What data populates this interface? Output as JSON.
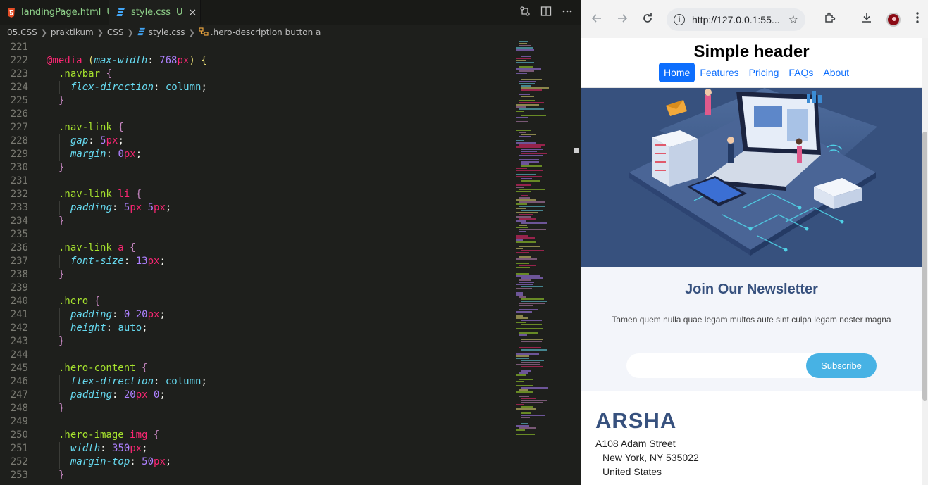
{
  "editor": {
    "tabs": [
      {
        "name": "landingPage.html",
        "status": "U"
      },
      {
        "name": "style.css",
        "status": "U",
        "close": "×"
      }
    ],
    "breadcrumb": [
      "05.CSS",
      "praktikum",
      "CSS",
      "style.css",
      ".hero-description button a"
    ],
    "lines": [
      {
        "n": "221",
        "indent": 0,
        "t": []
      },
      {
        "n": "222",
        "indent": 0,
        "t": [
          [
            "at",
            "@media "
          ],
          [
            "paren",
            "("
          ],
          [
            "prop",
            "max-width"
          ],
          [
            "punc",
            ": "
          ],
          [
            "num",
            "768"
          ],
          [
            "unit",
            "px"
          ],
          [
            "paren",
            ")"
          ],
          [
            "punc",
            " "
          ],
          [
            "paren",
            "{"
          ]
        ]
      },
      {
        "n": "223",
        "indent": 1,
        "t": [
          [
            "sel",
            ".navbar "
          ],
          [
            "brace",
            "{"
          ]
        ]
      },
      {
        "n": "224",
        "indent": 2,
        "t": [
          [
            "prop",
            "flex-direction"
          ],
          [
            "punc",
            ": "
          ],
          [
            "val",
            "column"
          ],
          [
            "punc",
            ";"
          ]
        ]
      },
      {
        "n": "225",
        "indent": 1,
        "t": [
          [
            "brace",
            "}"
          ]
        ]
      },
      {
        "n": "226",
        "indent": 0,
        "t": []
      },
      {
        "n": "227",
        "indent": 1,
        "t": [
          [
            "sel",
            ".nav-link "
          ],
          [
            "brace",
            "{"
          ]
        ]
      },
      {
        "n": "228",
        "indent": 2,
        "t": [
          [
            "prop",
            "gap"
          ],
          [
            "punc",
            ": "
          ],
          [
            "num",
            "5"
          ],
          [
            "unit",
            "px"
          ],
          [
            "punc",
            ";"
          ]
        ]
      },
      {
        "n": "229",
        "indent": 2,
        "t": [
          [
            "prop",
            "margin"
          ],
          [
            "punc",
            ": "
          ],
          [
            "num",
            "0"
          ],
          [
            "unit",
            "px"
          ],
          [
            "punc",
            ";"
          ]
        ]
      },
      {
        "n": "230",
        "indent": 1,
        "t": [
          [
            "brace",
            "}"
          ]
        ]
      },
      {
        "n": "231",
        "indent": 0,
        "t": []
      },
      {
        "n": "232",
        "indent": 1,
        "t": [
          [
            "sel",
            ".nav-link "
          ],
          [
            "tag",
            "li "
          ],
          [
            "brace",
            "{"
          ]
        ]
      },
      {
        "n": "233",
        "indent": 2,
        "t": [
          [
            "prop",
            "padding"
          ],
          [
            "punc",
            ": "
          ],
          [
            "num",
            "5"
          ],
          [
            "unit",
            "px "
          ],
          [
            "num",
            "5"
          ],
          [
            "unit",
            "px"
          ],
          [
            "punc",
            ";"
          ]
        ]
      },
      {
        "n": "234",
        "indent": 1,
        "t": [
          [
            "brace",
            "}"
          ]
        ]
      },
      {
        "n": "235",
        "indent": 0,
        "t": []
      },
      {
        "n": "236",
        "indent": 1,
        "t": [
          [
            "sel",
            ".nav-link "
          ],
          [
            "tag",
            "a "
          ],
          [
            "brace",
            "{"
          ]
        ]
      },
      {
        "n": "237",
        "indent": 2,
        "t": [
          [
            "prop",
            "font-size"
          ],
          [
            "punc",
            ": "
          ],
          [
            "num",
            "13"
          ],
          [
            "unit",
            "px"
          ],
          [
            "punc",
            ";"
          ]
        ]
      },
      {
        "n": "238",
        "indent": 1,
        "t": [
          [
            "brace",
            "}"
          ]
        ]
      },
      {
        "n": "239",
        "indent": 0,
        "t": []
      },
      {
        "n": "240",
        "indent": 1,
        "t": [
          [
            "sel",
            ".hero "
          ],
          [
            "brace",
            "{"
          ]
        ]
      },
      {
        "n": "241",
        "indent": 2,
        "t": [
          [
            "prop",
            "padding"
          ],
          [
            "punc",
            ": "
          ],
          [
            "num",
            "0 20"
          ],
          [
            "unit",
            "px"
          ],
          [
            "punc",
            ";"
          ]
        ]
      },
      {
        "n": "242",
        "indent": 2,
        "t": [
          [
            "prop",
            "height"
          ],
          [
            "punc",
            ": "
          ],
          [
            "val",
            "auto"
          ],
          [
            "punc",
            ";"
          ]
        ]
      },
      {
        "n": "243",
        "indent": 1,
        "t": [
          [
            "brace",
            "}"
          ]
        ]
      },
      {
        "n": "244",
        "indent": 0,
        "t": []
      },
      {
        "n": "245",
        "indent": 1,
        "t": [
          [
            "sel",
            ".hero-content "
          ],
          [
            "brace",
            "{"
          ]
        ]
      },
      {
        "n": "246",
        "indent": 2,
        "t": [
          [
            "prop",
            "flex-direction"
          ],
          [
            "punc",
            ": "
          ],
          [
            "val",
            "column"
          ],
          [
            "punc",
            ";"
          ]
        ]
      },
      {
        "n": "247",
        "indent": 2,
        "t": [
          [
            "prop",
            "padding"
          ],
          [
            "punc",
            ": "
          ],
          [
            "num",
            "20"
          ],
          [
            "unit",
            "px "
          ],
          [
            "num",
            "0"
          ],
          [
            "punc",
            ";"
          ]
        ]
      },
      {
        "n": "248",
        "indent": 1,
        "t": [
          [
            "brace",
            "}"
          ]
        ]
      },
      {
        "n": "249",
        "indent": 0,
        "t": []
      },
      {
        "n": "250",
        "indent": 1,
        "t": [
          [
            "sel",
            ".hero-image "
          ],
          [
            "tag",
            "img "
          ],
          [
            "brace",
            "{"
          ]
        ]
      },
      {
        "n": "251",
        "indent": 2,
        "t": [
          [
            "prop",
            "width"
          ],
          [
            "punc",
            ": "
          ],
          [
            "num",
            "350"
          ],
          [
            "unit",
            "px"
          ],
          [
            "punc",
            ";"
          ]
        ]
      },
      {
        "n": "252",
        "indent": 2,
        "t": [
          [
            "prop",
            "margin-top"
          ],
          [
            "punc",
            ": "
          ],
          [
            "num",
            "50"
          ],
          [
            "unit",
            "px"
          ],
          [
            "punc",
            ";"
          ]
        ]
      },
      {
        "n": "253",
        "indent": 1,
        "t": [
          [
            "brace",
            "}"
          ]
        ]
      }
    ]
  },
  "browser": {
    "url": "http://127.0.0.1:55...",
    "page": {
      "header_title": "Simple header",
      "nav": [
        "Home",
        "Features",
        "Pricing",
        "FAQs",
        "About"
      ],
      "active_nav": "Home",
      "newsletter_title": "Join Our Newsletter",
      "newsletter_desc": "Tamen quem nulla quae legam multos aute sint culpa legam noster magna",
      "input_value": "",
      "subscribe_label": "Subscribe",
      "brand": "ARSHA",
      "address": [
        "A108 Adam Street",
        "New York, NY 535022",
        "United States"
      ]
    }
  },
  "colors": {
    "accent": "#47b2e4",
    "brand": "#37517e",
    "nav_active": "#0d6efd",
    "editor_bg": "#1e1f1c"
  },
  "icons": [
    "html-file-icon",
    "css-file-icon",
    "compare-icon",
    "split-editor-icon",
    "more-icon",
    "back-icon",
    "forward-icon",
    "reload-icon",
    "info-icon",
    "star-icon",
    "extensions-icon",
    "download-icon",
    "profile-avatar",
    "kebab-menu-icon"
  ]
}
